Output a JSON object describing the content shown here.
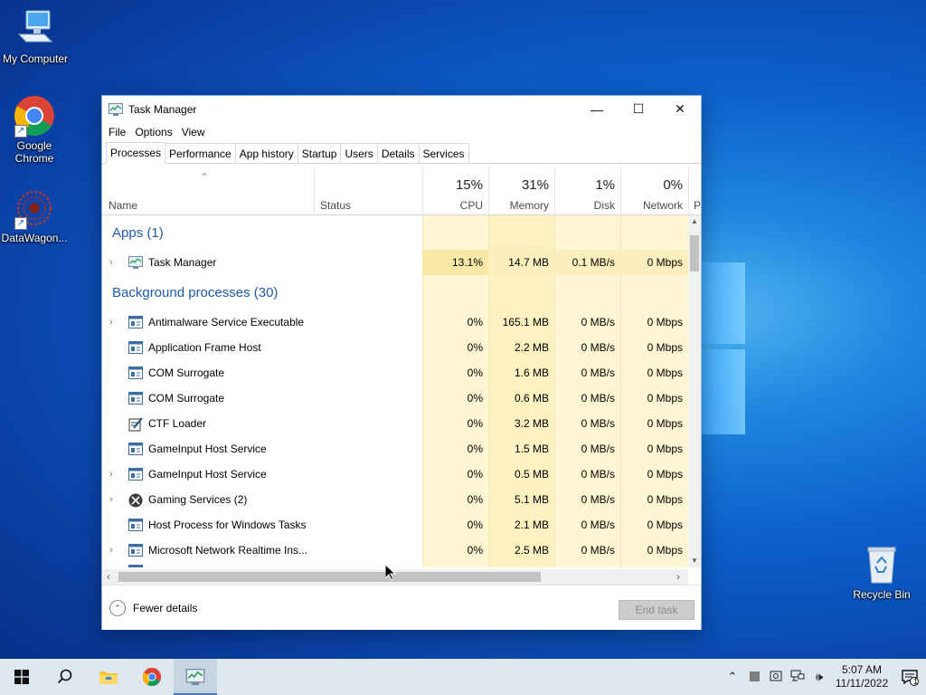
{
  "desktop": {
    "icons": [
      {
        "label": "My Computer"
      },
      {
        "label": "Google Chrome"
      },
      {
        "label": "DataWagon..."
      },
      {
        "label": "Recycle Bin"
      }
    ]
  },
  "window": {
    "title": "Task Manager",
    "menu": [
      "File",
      "Options",
      "View"
    ],
    "tabs": [
      "Processes",
      "Performance",
      "App history",
      "Startup",
      "Users",
      "Details",
      "Services"
    ],
    "active_tab": "Processes",
    "controls": {
      "minimize": "—",
      "maximize": "☐",
      "close": "✕"
    }
  },
  "columns": {
    "name": "Name",
    "status": "Status",
    "cpu": {
      "percent": "15%",
      "label": "CPU"
    },
    "memory": {
      "percent": "31%",
      "label": "Memory"
    },
    "disk": {
      "percent": "1%",
      "label": "Disk"
    },
    "network": {
      "percent": "0%",
      "label": "Network"
    },
    "power_partial": "P"
  },
  "groups": {
    "apps": "Apps (1)",
    "background": "Background processes (30)"
  },
  "processes": [
    {
      "name": "Task Manager",
      "cpu": "13.1%",
      "memory": "14.7 MB",
      "disk": "0.1 MB/s",
      "network": "0 Mbps",
      "expandable": true,
      "icon": "task-manager-icon"
    },
    {
      "name": "Antimalware Service Executable",
      "cpu": "0%",
      "memory": "165.1 MB",
      "disk": "0 MB/s",
      "network": "0 Mbps",
      "expandable": true,
      "icon": "service-icon"
    },
    {
      "name": "Application Frame Host",
      "cpu": "0%",
      "memory": "2.2 MB",
      "disk": "0 MB/s",
      "network": "0 Mbps",
      "expandable": false,
      "icon": "service-icon"
    },
    {
      "name": "COM Surrogate",
      "cpu": "0%",
      "memory": "1.6 MB",
      "disk": "0 MB/s",
      "network": "0 Mbps",
      "expandable": false,
      "icon": "service-icon"
    },
    {
      "name": "COM Surrogate",
      "cpu": "0%",
      "memory": "0.6 MB",
      "disk": "0 MB/s",
      "network": "0 Mbps",
      "expandable": false,
      "icon": "service-icon"
    },
    {
      "name": "CTF Loader",
      "cpu": "0%",
      "memory": "3.2 MB",
      "disk": "0 MB/s",
      "network": "0 Mbps",
      "expandable": false,
      "icon": "ctf-loader-icon"
    },
    {
      "name": "GameInput Host Service",
      "cpu": "0%",
      "memory": "1.5 MB",
      "disk": "0 MB/s",
      "network": "0 Mbps",
      "expandable": false,
      "icon": "service-icon"
    },
    {
      "name": "GameInput Host Service",
      "cpu": "0%",
      "memory": "0.5 MB",
      "disk": "0 MB/s",
      "network": "0 Mbps",
      "expandable": true,
      "icon": "service-icon"
    },
    {
      "name": "Gaming Services (2)",
      "cpu": "0%",
      "memory": "5.1 MB",
      "disk": "0 MB/s",
      "network": "0 Mbps",
      "expandable": true,
      "icon": "xbox-icon"
    },
    {
      "name": "Host Process for Windows Tasks",
      "cpu": "0%",
      "memory": "2.1 MB",
      "disk": "0 MB/s",
      "network": "0 Mbps",
      "expandable": false,
      "icon": "service-icon"
    },
    {
      "name": "Microsoft Network Realtime Ins...",
      "cpu": "0%",
      "memory": "2.5 MB",
      "disk": "0 MB/s",
      "network": "0 Mbps",
      "expandable": true,
      "icon": "service-icon"
    }
  ],
  "footer": {
    "fewer_details": "Fewer details",
    "end_task": "End task"
  },
  "taskbar": {
    "time": "5:07 AM",
    "date": "11/11/2022",
    "notification_count": "1"
  },
  "colors": {
    "accent": "#1e5aa8",
    "cpu_highlight": "#f9e8a6",
    "column_tint": "#fff7d4",
    "memory_tint": "#fdf1c0"
  }
}
